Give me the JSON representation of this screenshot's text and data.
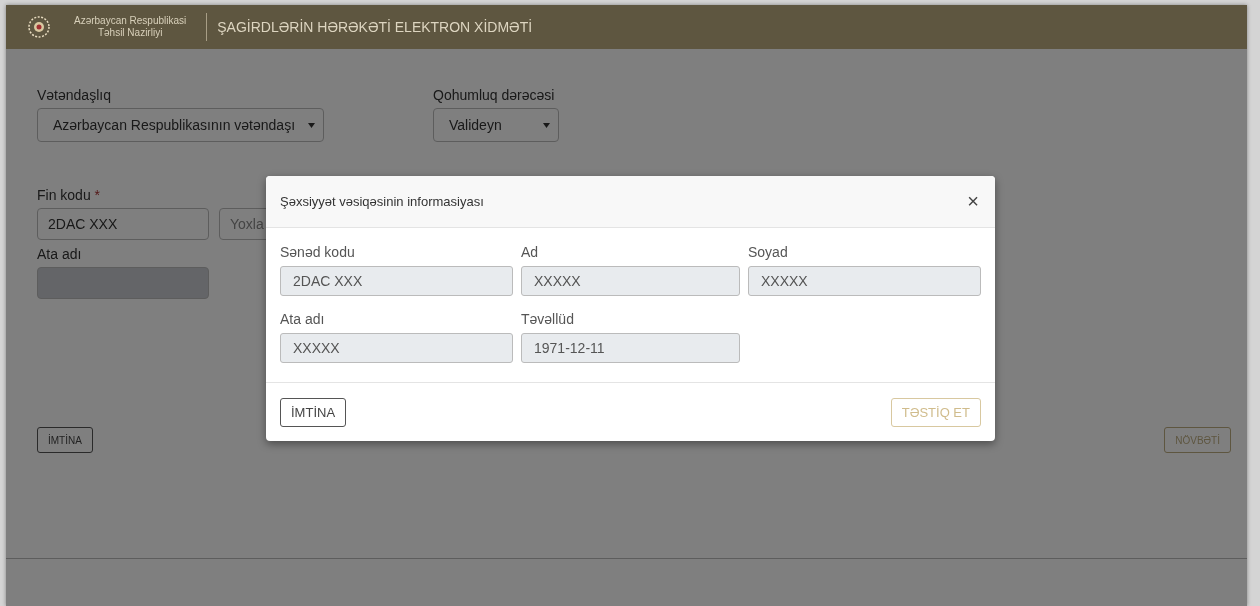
{
  "header": {
    "ministry_line_1": "Azərbaycan Respublikasi",
    "ministry_line_2": "Təhsil Nazirliyi",
    "title": "ŞAGİRDLƏRİN HƏRƏKƏTİ ELEKTRON XİDMƏTİ"
  },
  "form": {
    "citizenship": {
      "label": "Vətəndaşlıq",
      "value": "Azərbaycan Respublikasının vətəndaşı"
    },
    "relation": {
      "label": "Qohumluq dərəcəsi",
      "value": "Valideyn"
    },
    "fin": {
      "label": "Fin kodu",
      "required_mark": "*",
      "value": "2DAC XXX",
      "check_button": "Yoxla"
    },
    "father_name": {
      "label": "Ata adı",
      "disabled": true
    },
    "cancel_button": "İMTİNA",
    "next_button": "NÖVBƏTİ"
  },
  "modal": {
    "title": "Şəxsiyyət vəsiqəsinin informasiyası",
    "close": "×",
    "fields": [
      {
        "label": "Sənəd kodu",
        "value": "2DAC XXX"
      },
      {
        "label": "Ad",
        "value": "XXXXX"
      },
      {
        "label": "Soyad",
        "value": "XXXXX"
      },
      {
        "label": "Ata adı",
        "value": "XXXXX"
      },
      {
        "label": "Təvəllüd",
        "value": "1971-12-11"
      }
    ],
    "cancel_button": "İMTİNA",
    "confirm_button": "TƏSTİQ ET"
  }
}
